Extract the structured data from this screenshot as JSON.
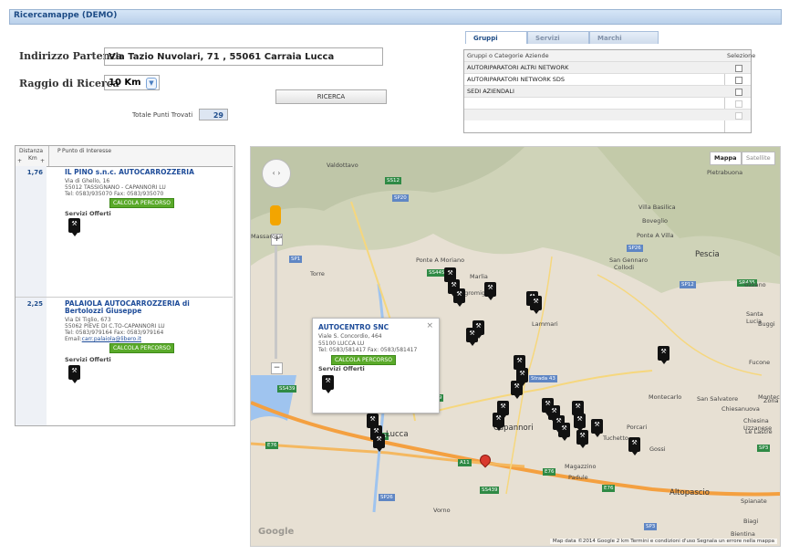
{
  "window": {
    "title": "Ricercamappe (DEMO)"
  },
  "search": {
    "address_label": "Indirizzo Partenza",
    "address_value": "Via Tazio Nuvolari, 71 , 55061 Carraia Lucca",
    "radius_label": "Raggio di Ricerca",
    "radius_value": "10 Km",
    "search_button": "RICERCA",
    "total_label": "Totale Punti Trovati",
    "total_value": "29"
  },
  "tabs": [
    "Gruppi",
    "Servizi",
    "Marchi"
  ],
  "groups": {
    "col1": "Gruppi o Categorie Aziende",
    "col2": "Selezione",
    "rows": [
      "AUTORIPARATORI ALTRI NETWORK",
      "AUTORIPARATORI NETWORK SDS",
      "SEDI AZIENDALI"
    ]
  },
  "list": {
    "col_distance": "Distanza",
    "col_km": "Km",
    "col_p": "P",
    "col_poi": "Punto di Interesse",
    "items": [
      {
        "distance": "1,76",
        "name": "IL PINO s.n.c. AUTOCARROZZERIA",
        "line1": "Via di Ghello, 16",
        "line2": "55012 TASSIGNANO - CAPANNORI LU",
        "line3": "Tel: 0583/935070 Fax: 0583/935070",
        "calc": "CALCOLA PERCORSO",
        "services": "Servizi Offerti"
      },
      {
        "distance": "2,25",
        "name": "PALAIOLA AUTOCARROZZERIA di Bertolozzi Giuseppe",
        "line1": "Via Di Tiglio, 673",
        "line2": "55062 PIEVE DI C.TO-CAPANNORI LU",
        "line3": "Tel: 0583/979164 Fax: 0583/979164",
        "email_label": "Email:",
        "email": "carr.palaiola@libero.it",
        "calc": "CALCOLA PERCORSO",
        "services": "Servizi Offerti"
      }
    ]
  },
  "map": {
    "type_map": "Mappa",
    "type_sat": "Satellite",
    "popup": {
      "name": "AUTOCENTRO SNC",
      "line1": "Viale S. Concordio, 464",
      "line2": "55100 LUCCA LU",
      "line3": "Tel: 0583/581417 Fax: 0583/581417",
      "calc": "CALCOLA PERCORSO",
      "services": "Servizi Offerti",
      "close": "×"
    },
    "towns": [
      "Valdottavo",
      "Pietrabuona",
      "Villa Basilica",
      "Boveglio",
      "Ponte A Villa",
      "Pescia",
      "Uzzano",
      "Santa Lucia",
      "Buggi",
      "Fucone",
      "Montecarlo",
      "Collodi",
      "San Gennaro",
      "Torre",
      "Ponte A Moriano",
      "Marlia",
      "Lammari",
      "Segromigno",
      "Capannori",
      "Lucca",
      "Massarosa",
      "Montecatini",
      "Chiesanuova",
      "San Salvatore",
      "Porcari",
      "Tuchetto",
      "Gossi",
      "Altopascio",
      "Magazzino",
      "Padule",
      "Spianate",
      "Biagi",
      "Bientina",
      "Vorno",
      "Zona",
      "Le Lastre",
      "Chiesina Uzzanese"
    ],
    "footer": "Map data ©2014 Google  2 km    Termini e condizioni d'uso  Segnala un errore nella mappa",
    "google": "Google"
  },
  "icons": {
    "marker": "wrench-pin-icon",
    "destination": "red-pin-icon"
  },
  "colors": {
    "title": "#1e4c86",
    "link": "#1e4c99",
    "calc": "#5aaa2a",
    "map_bg": "#e7e0d3"
  }
}
